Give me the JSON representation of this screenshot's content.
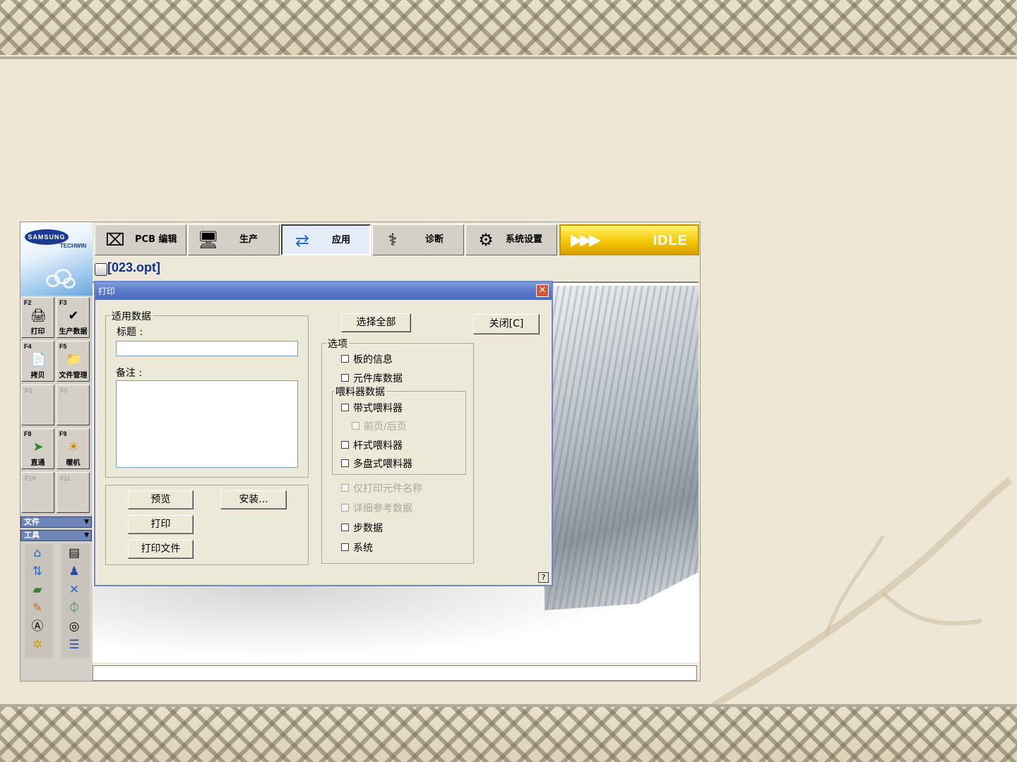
{
  "app": {
    "logo": {
      "brand": "SAMSUNG",
      "sub": "TECHWIN"
    },
    "file": "[023.opt]",
    "status": "IDLE",
    "tabs": [
      {
        "label": "PCB 编辑",
        "icon": "pcb-edit-icon"
      },
      {
        "label": "生产",
        "icon": "production-icon"
      },
      {
        "label": "应用",
        "icon": "application-icon",
        "active": true
      },
      {
        "label": "诊断",
        "icon": "diagnosis-icon"
      },
      {
        "label": "系统设置",
        "icon": "system-settings-icon"
      }
    ],
    "fkeys": [
      {
        "key": "F2",
        "label": "打印",
        "icon": "print-icon"
      },
      {
        "key": "F3",
        "label": "生产数据",
        "icon": "production-data-icon"
      },
      {
        "key": "F4",
        "label": "拷贝",
        "icon": "copy-icon"
      },
      {
        "key": "F5",
        "label": "文件管理",
        "icon": "file-manager-icon"
      },
      {
        "key": "F6",
        "label": "",
        "disabled": true
      },
      {
        "key": "F7",
        "label": "",
        "disabled": true
      },
      {
        "key": "F8",
        "label": "直通",
        "icon": "pass-through-icon"
      },
      {
        "key": "F9",
        "label": "暖机",
        "icon": "warmup-icon"
      },
      {
        "key": "F10",
        "label": "",
        "disabled": true
      },
      {
        "key": "F11",
        "label": "",
        "disabled": true
      }
    ],
    "menus": [
      {
        "label": "文件"
      },
      {
        "label": "工具"
      }
    ],
    "tool_icons": [
      "home-icon",
      "window-icon",
      "reference-icon",
      "person-icon",
      "board-icon",
      "axis-icon",
      "pencil-icon",
      "cylinder-icon",
      "auto-icon",
      "film-icon",
      "gear-icon",
      "list-icon"
    ]
  },
  "dialog": {
    "title": "打印",
    "group_data": {
      "legend": "适用数据",
      "title_label": "标题 :",
      "title_value": "",
      "note_label": "备注 :",
      "note_value": ""
    },
    "buttons": {
      "preview": "预览",
      "setup": "安装...",
      "print": "打印",
      "print_file": "打印文件",
      "select_all": "选择全部",
      "close": "关闭[C]"
    },
    "options": {
      "legend": "选项",
      "board_info": "板的信息",
      "component_lib": "元件库数据",
      "feeder_legend": "喂料器数据",
      "tape_feeder": "带式喂料器",
      "front_rear": "前页/后页",
      "stick_feeder": "杆式喂料器",
      "tray_feeder": "多盘式喂料器",
      "print_name_only": "仅打印元件名称",
      "detail_ref": "详细参考数据",
      "step_data": "步数据",
      "system": "系统"
    },
    "help": "?"
  }
}
